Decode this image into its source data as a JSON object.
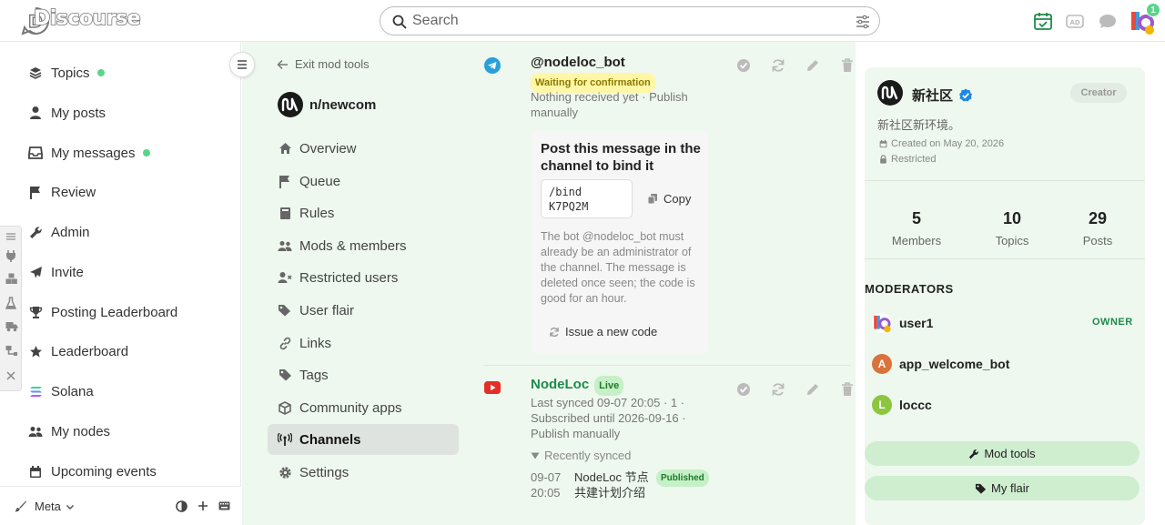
{
  "header": {
    "logo_text": "Discourse",
    "search_placeholder": "Search",
    "notification_count": "1"
  },
  "sidebar": {
    "items": [
      {
        "label": "Topics",
        "icon": "layers-icon",
        "dot": true
      },
      {
        "label": "My posts",
        "icon": "user-icon",
        "dot": false
      },
      {
        "label": "My messages",
        "icon": "inbox-icon",
        "dot": true
      },
      {
        "label": "Review",
        "icon": "flag-icon",
        "dot": false
      },
      {
        "label": "Admin",
        "icon": "wrench-icon",
        "dot": false
      },
      {
        "label": "Invite",
        "icon": "paper-plane-icon",
        "dot": false
      },
      {
        "label": "Posting Leaderboard",
        "icon": "trophy-icon",
        "dot": false
      },
      {
        "label": "Leaderboard",
        "icon": "star-icon",
        "dot": false
      },
      {
        "label": "Solana",
        "icon": "solana-icon",
        "dot": false
      },
      {
        "label": "My nodes",
        "icon": "users-icon",
        "dot": false
      },
      {
        "label": "Upcoming events",
        "icon": "calendar-icon",
        "dot": false
      }
    ],
    "footer": {
      "meta_label": "Meta"
    }
  },
  "modnav": {
    "exit_label": "Exit mod tools",
    "community_name": "n/newcom",
    "items": [
      {
        "label": "Overview",
        "icon": "home-icon"
      },
      {
        "label": "Queue",
        "icon": "flag-icon"
      },
      {
        "label": "Rules",
        "icon": "book-icon"
      },
      {
        "label": "Mods & members",
        "icon": "users-icon"
      },
      {
        "label": "Restricted users",
        "icon": "user-x-icon"
      },
      {
        "label": "User flair",
        "icon": "tag-icon"
      },
      {
        "label": "Links",
        "icon": "link-icon"
      },
      {
        "label": "Tags",
        "icon": "tag-icon"
      },
      {
        "label": "Community apps",
        "icon": "box-icon"
      },
      {
        "label": "Channels",
        "icon": "broadcast-icon",
        "active": true
      },
      {
        "label": "Settings",
        "icon": "gear-icon"
      }
    ]
  },
  "channels": {
    "telegram": {
      "name": "@nodeloc_bot",
      "status": "Waiting for confirmation",
      "meta": "Nothing received yet · Publish manually",
      "bind": {
        "title": "Post this message in the channel to bind it",
        "code": "/bind K7PQ2M",
        "copy_label": "Copy",
        "note": "The bot @nodeloc_bot must already be an administrator of the channel. The message is deleted once seen; the code is good for an hour.",
        "reissue_label": "Issue a new code"
      }
    },
    "youtube": {
      "name": "NodeLoc",
      "status": "Live",
      "meta": "Last synced 09-07 20:05 · 1 · Subscribed until 2026-09-16 · Publish manually",
      "recent_label": "Recently synced",
      "recent": [
        {
          "time": "09-07 20:05",
          "title": "NodeLoc 节点共建计划介绍",
          "status": "Published"
        }
      ]
    }
  },
  "card": {
    "name": "新社区",
    "role_badge": "Creator",
    "description": "新社区新环境。",
    "created": "Created on May 20, 2026",
    "visibility": "Restricted",
    "stats": [
      {
        "value": "5",
        "label": "Members"
      },
      {
        "value": "10",
        "label": "Topics"
      },
      {
        "value": "29",
        "label": "Posts"
      }
    ],
    "moderators_heading": "MODERATORS",
    "moderators": [
      {
        "name": "user1",
        "avatar_letter": "",
        "color": "#ffffff",
        "owner": "OWNER"
      },
      {
        "name": "app_welcome_bot",
        "avatar_letter": "A",
        "color": "#d9733b",
        "owner": ""
      },
      {
        "name": "loccc",
        "avatar_letter": "L",
        "color": "#8cc63f",
        "owner": ""
      }
    ],
    "buttons": {
      "mod_tools": "Mod tools",
      "my_flair": "My flair"
    }
  },
  "colors": {
    "accent_green": "#5ad48a",
    "panel_bg": "#eef8ee",
    "telegram": "#2a9fd9",
    "youtube": "#e52d27"
  }
}
